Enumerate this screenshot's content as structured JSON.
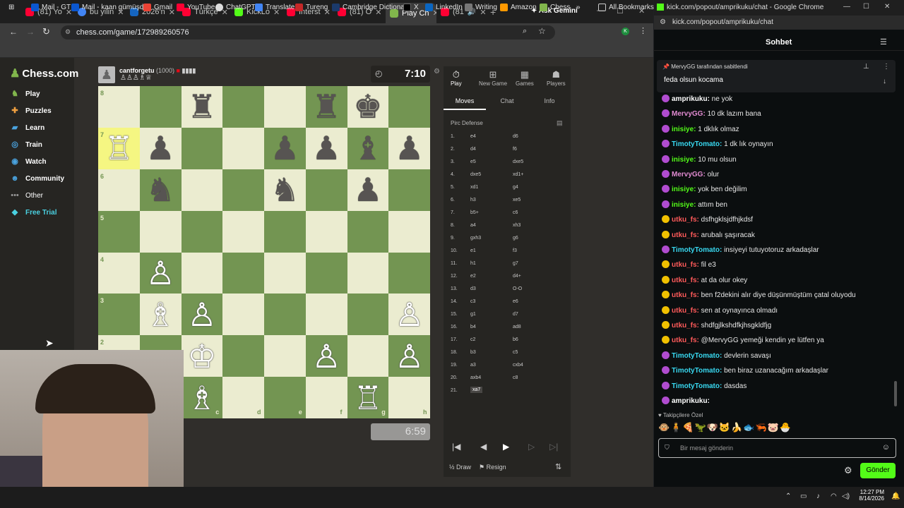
{
  "left_window": {
    "tabs": [
      "(81) Yo",
      "bu yilin",
      "2026'n",
      "Türkçe",
      "KickLo",
      "Interst",
      "(81) O",
      "Play Ch",
      "(81"
    ],
    "ask_gemini": "Ask Gemini",
    "url": "chess.com/game/172989260576",
    "bookmarks": [
      "Mail - GT",
      "Mail - kaan gümüşd...",
      "Gmail",
      "YouTube",
      "ChatGPT",
      "Translate",
      "Tureng",
      "Cambridge Dictiona...",
      "X",
      "LinkedIn",
      "Writing",
      "Amazon",
      "Chess",
      "All Bookmarks"
    ]
  },
  "chess": {
    "logo": "Chess.com",
    "nav": [
      {
        "label": "Play",
        "icon": "play-icon",
        "color": "#81b64c"
      },
      {
        "label": "Puzzles",
        "icon": "puzzle-icon",
        "color": "#f0a040"
      },
      {
        "label": "Learn",
        "icon": "learn-icon",
        "color": "#4aa3df"
      },
      {
        "label": "Train",
        "icon": "train-icon",
        "color": "#4aa3df"
      },
      {
        "label": "Watch",
        "icon": "watch-icon",
        "color": "#4aa3df"
      },
      {
        "label": "Community",
        "icon": "community-icon",
        "color": "#4aa3df"
      },
      {
        "label": "Other",
        "icon": "other-icon",
        "color": "#999999"
      },
      {
        "label": "Free Trial",
        "icon": "diamond-icon",
        "color": "#4ad0e0"
      }
    ],
    "opponent": {
      "name": "cantforgetu",
      "rating": "(1000)",
      "clock": "7:10"
    },
    "player_clock": "6:59",
    "file_labels": [
      "c",
      "d",
      "e",
      "f",
      "g",
      "h"
    ],
    "rank_labels": [
      "8",
      "7",
      "6",
      "5",
      "4",
      "3",
      "2"
    ],
    "panel_tabs": {
      "play": "Play",
      "new_game": "New Game",
      "games": "Games",
      "players": "Players"
    },
    "move_tabs": {
      "moves": "Moves",
      "chat": "Chat",
      "info": "Info"
    },
    "opening": "Pirc Defense",
    "moves": [
      [
        "1.",
        "e4",
        "d6"
      ],
      [
        "2.",
        "d4",
        "f6"
      ],
      [
        "3.",
        "e5",
        "dxe5"
      ],
      [
        "4.",
        "dxe5",
        "xd1+"
      ],
      [
        "5.",
        "xd1",
        "g4"
      ],
      [
        "6.",
        "h3",
        "xe5"
      ],
      [
        "7.",
        "b5+",
        "c6"
      ],
      [
        "8.",
        "a4",
        "xh3"
      ],
      [
        "9.",
        "gxh3",
        "g6"
      ],
      [
        "10.",
        "e1",
        "f3"
      ],
      [
        "11.",
        "h1",
        "g7"
      ],
      [
        "12.",
        "e2",
        "d4+"
      ],
      [
        "13.",
        "d3",
        "O-O"
      ],
      [
        "14.",
        "c3",
        "e6"
      ],
      [
        "15.",
        "g1",
        "d7"
      ],
      [
        "16.",
        "b4",
        "ad8"
      ],
      [
        "17.",
        "c2",
        "b6"
      ],
      [
        "18.",
        "b3",
        "c5"
      ],
      [
        "19.",
        "a3",
        "cxb4"
      ],
      [
        "20.",
        "axb4",
        "c8"
      ],
      [
        "21.",
        "xa7",
        ""
      ]
    ],
    "controls": {
      "draw": "Draw",
      "resign": "Resign"
    }
  },
  "kick": {
    "title": "kick.com/popout/amprikuku/chat - Google Chrome",
    "url": "kick.com/popout/amprikuku/chat",
    "header": "Sohbet",
    "pinned_by": "MervyGG tarafından sabitlendi",
    "pinned_msg": "feda olsun kocama",
    "messages": [
      {
        "user": "amprikuku",
        "text": "ne yok",
        "color": "#ffffff"
      },
      {
        "user": "MervyGG",
        "text": "10 dk lazım bana",
        "color": "#e08ad0"
      },
      {
        "user": "inisiye",
        "text": "1 dklık olmaz",
        "color": "#53fc18"
      },
      {
        "user": "TimotyTomato",
        "text": "1 dk lık oynayın",
        "color": "#38d8f0"
      },
      {
        "user": "inisiye",
        "text": "10 mu olsun",
        "color": "#53fc18"
      },
      {
        "user": "MervyGG",
        "text": "olur",
        "color": "#e08ad0"
      },
      {
        "user": "inisiye",
        "text": "yok ben değilim",
        "color": "#53fc18"
      },
      {
        "user": "inisiye",
        "text": "attım ben",
        "color": "#53fc18"
      },
      {
        "user": "utku_fs",
        "text": "dsfhgklsjdfhjkdsf",
        "color": "#ff5a5a"
      },
      {
        "user": "utku_fs",
        "text": "arubalı şaşıracak",
        "color": "#ff5a5a"
      },
      {
        "user": "TimotyTomato",
        "text": "insiyeyi tutuyotoruz arkadaşlar",
        "color": "#38d8f0"
      },
      {
        "user": "utku_fs",
        "text": "fil e3",
        "color": "#ff5a5a"
      },
      {
        "user": "utku_fs",
        "text": "at da olur okey",
        "color": "#ff5a5a"
      },
      {
        "user": "utku_fs",
        "text": "ben f2dekini alır diye düşünmüştüm çatal oluyodu",
        "color": "#ff5a5a"
      },
      {
        "user": "utku_fs",
        "text": "sen at oynayınca olmadı",
        "color": "#ff5a5a"
      },
      {
        "user": "utku_fs",
        "text": "shdfgjlkshdfkjhsgkldfjg",
        "color": "#ff5a5a"
      },
      {
        "user": "utku_fs",
        "text": "@MervyGG yemeği kendin ye lütfen ya",
        "color": "#ff5a5a"
      },
      {
        "user": "TimotyTomato",
        "text": "devlerin savaşı",
        "color": "#38d8f0"
      },
      {
        "user": "TimotyTomato",
        "text": "ben biraz uzanacağım arkadaşlar",
        "color": "#38d8f0"
      },
      {
        "user": "TimotyTomato",
        "text": "dasdas",
        "color": "#38d8f0"
      },
      {
        "user": "amprikuku",
        "text": "",
        "color": "#ffffff"
      }
    ],
    "followers_label": "Takipçilere Özel",
    "input_placeholder": "Bir mesaj gönderin",
    "send": "Gönder"
  },
  "taskbar": {
    "time": "12:27 PM",
    "date": "8/14/2026"
  }
}
